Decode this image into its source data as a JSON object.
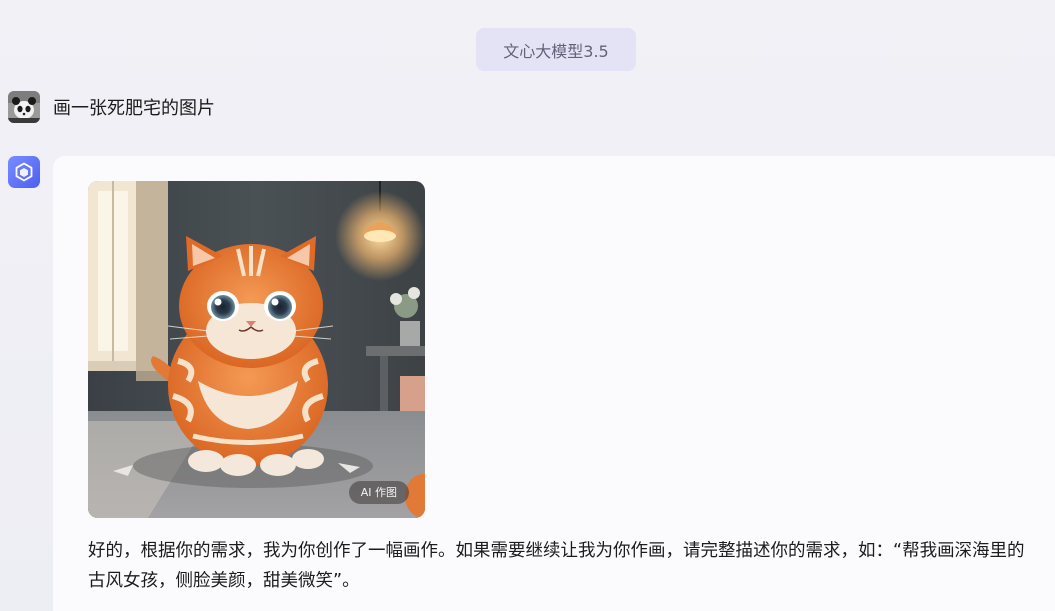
{
  "header": {
    "model_badge": "文心大模型3.5"
  },
  "conversation": {
    "user_message": "画一张死肥宅的图片",
    "user_avatar_icon": "panda-avatar",
    "bot_avatar_icon": "ernie-cube-logo-icon",
    "generated_image": {
      "subject": "orange-tabby-cat-image",
      "tag_label": "AI 作图"
    },
    "reply_text": "好的，根据你的需求，我为你创作了一幅画作。如果需要继续让我为你作画，请完整描述你的需求，如：“帮我画深海里的古风女孩，侧脸美颜，甜美微笑”。"
  },
  "colors": {
    "badge_bg": "#e4e3f5",
    "card_bg": "#fbfbfe",
    "bot_avatar": "#5b6cf5",
    "cat_orange": "#e8782f"
  }
}
